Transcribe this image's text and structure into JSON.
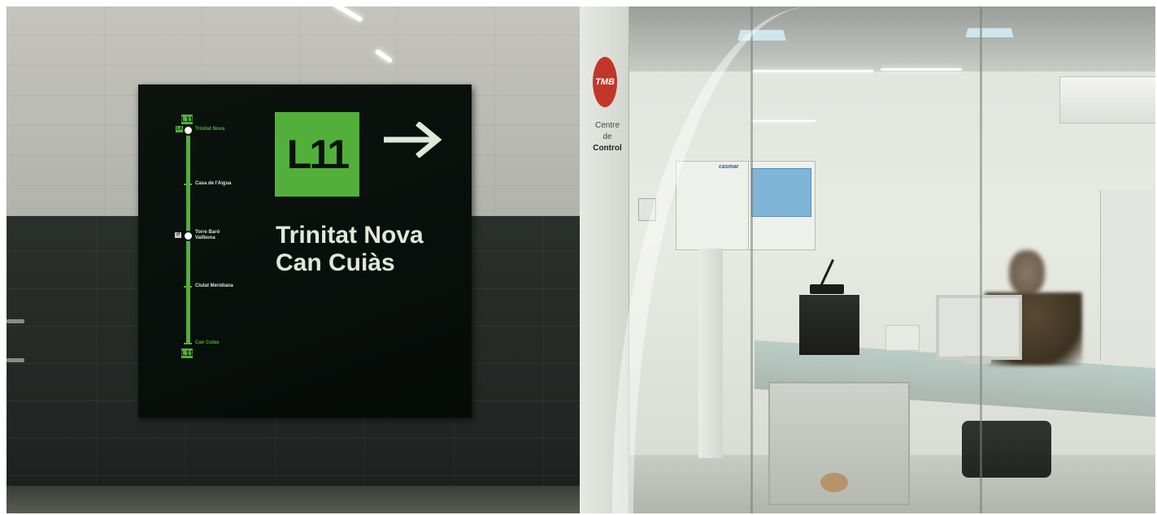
{
  "sign": {
    "line_small_top": "L11",
    "interchange_line": "L4",
    "line_small_bottom": "L11",
    "stations": [
      {
        "name": "Trinitat Nova"
      },
      {
        "name": "Casa de l'Aigua"
      },
      {
        "name": "Torre Baró Vallbona"
      },
      {
        "name": "Ciutat Meridiana"
      },
      {
        "name": "Can Cuiàs"
      }
    ],
    "connector_badge": "rf",
    "big_badge": "L11",
    "destinations": [
      "Trinitat Nova",
      "Can Cuiàs"
    ],
    "arrow_icon": "arrow-right-icon"
  },
  "control_room": {
    "logo_text": "TMB",
    "label_line1": "Centre",
    "label_line2_prefix": "de",
    "label_line2_bold": "Control",
    "panel_brand": "casmar"
  },
  "colors": {
    "line_green": "#52b03a",
    "sign_background": "#0c130f",
    "tmb_red": "#c2362a"
  }
}
